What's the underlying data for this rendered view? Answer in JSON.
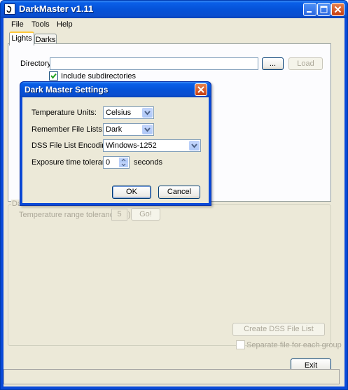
{
  "window": {
    "title": "DarkMaster v1.11"
  },
  "menu": [
    "File",
    "Tools",
    "Help"
  ],
  "tabs": [
    {
      "label": "Lights"
    },
    {
      "label": "Darks"
    }
  ],
  "lights": {
    "directory_label": "Directory:",
    "directory_value": "",
    "browse_label": "...",
    "load_label": "Load",
    "include_subdirs_label": "Include subdirectories",
    "include_subdirs_checked": true
  },
  "darks_group": {
    "title": "Da",
    "temp_range_label": "Temperature range tolerance (C):",
    "temp_range_value": "5",
    "go_label": "Go!"
  },
  "actions": {
    "create_dss_label": "Create DSS File List",
    "separate_file_label": "Separate file for each group",
    "separate_file_checked": false,
    "exit_label": "Exit"
  },
  "dialog": {
    "title": "Dark Master Settings",
    "temp_units_label": "Temperature Units:",
    "temp_units_value": "Celsius",
    "remember_lists_label": "Remember File Lists:",
    "remember_lists_value": "Dark",
    "encoding_label": "DSS File List Encoding:",
    "encoding_value": "Windows-1252",
    "exposure_label": "Exposure time tolerance:",
    "exposure_value": "0",
    "exposure_unit": "seconds",
    "ok_label": "OK",
    "cancel_label": "Cancel"
  },
  "colors": {
    "titlebar": "#0a5fe8",
    "client": "#ece9d8",
    "checkmark": "#21a121",
    "close_button": "#c53c10"
  }
}
